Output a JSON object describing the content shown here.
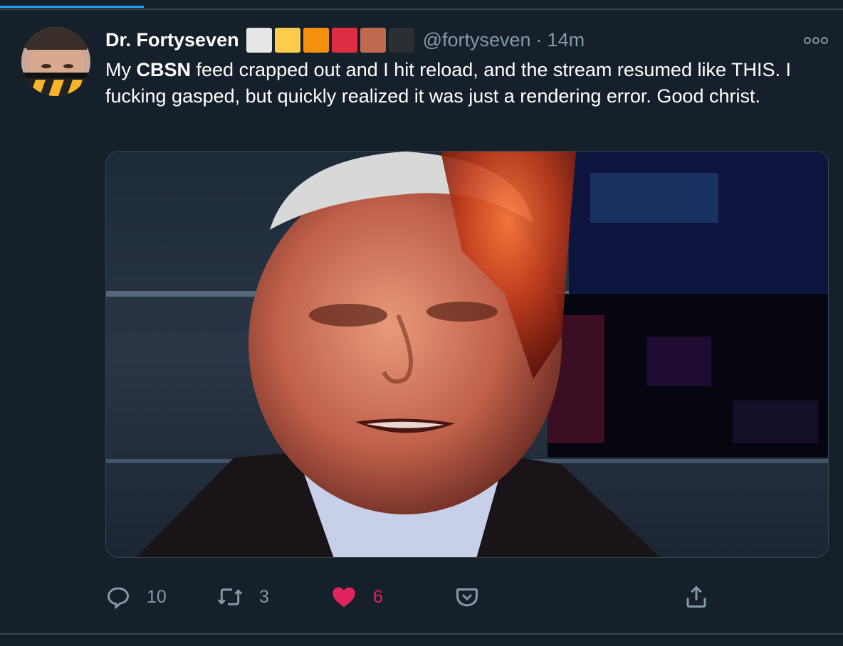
{
  "tweet": {
    "display_name": "Dr. Fortyseven",
    "name_swatches": [
      "#e6e6e6",
      "#ffcc4d",
      "#f4900c",
      "#dd2e44",
      "#c1694f",
      "#292f33"
    ],
    "handle": "@fortyseven",
    "separator": "·",
    "time": "14m",
    "text_before": "My ",
    "text_bold": "CBSN",
    "text_after": " feed crapped out and I hit reload, and the stream resumed like THIS. I fucking gasped, but quickly realized it was just a rendering error. Good christ."
  },
  "actions": {
    "replies": {
      "icon": "reply-icon",
      "count": "10"
    },
    "retweets": {
      "icon": "retweet-icon",
      "count": "3"
    },
    "likes": {
      "icon": "heart-icon",
      "count": "6",
      "liked": true,
      "color": "#e0245e"
    },
    "bookmark": {
      "icon": "pocket-save-icon"
    },
    "share": {
      "icon": "share-icon"
    }
  },
  "colors": {
    "background": "#15202b",
    "border": "#38444d",
    "secondary_text": "#8899a6",
    "accent": "#1da1f2"
  }
}
